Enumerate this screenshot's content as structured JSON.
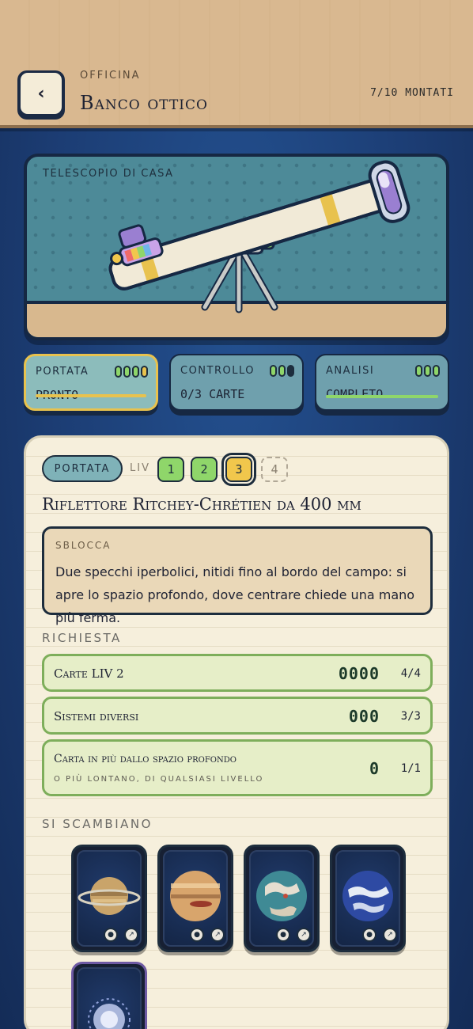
{
  "header": {
    "subtitle": "OFFICINA",
    "title": "Banco ottico",
    "count": "7/10 MONTATI",
    "back_glyph": "‹"
  },
  "scene": {
    "label": "TELESCOPIO DI CASA"
  },
  "stats": [
    {
      "label": "PORTATA",
      "value": "PRONTO",
      "pips": [
        "green",
        "green",
        "green",
        "yellow"
      ],
      "bar_color": "#e8c24e",
      "active": true
    },
    {
      "label": "CONTROLLO",
      "value": "0/3 CARTE",
      "pips": [
        "green",
        "green",
        "dark"
      ],
      "bar_color": null,
      "active": false
    },
    {
      "label": "ANALISI",
      "value": "COMPLETO",
      "pips": [
        "green",
        "green",
        "green"
      ],
      "bar_color": "#8fd66a",
      "active": false
    }
  ],
  "panel": {
    "chip": "PORTATA",
    "liv_label": "LIV",
    "levels": [
      {
        "label": "1",
        "state": "green"
      },
      {
        "label": "2",
        "state": "green"
      },
      {
        "label": "3",
        "state": "current"
      },
      {
        "label": "4",
        "state": "locked"
      }
    ],
    "item_title": "Riflettore Ritchey-Chrétien da 400 mm",
    "unlock": {
      "label": "SBLOCCA",
      "text": "Due specchi iperbolici, nitidi fino al bordo del campo: si apre lo spazio profondo, dove centrare chiede una mano più ferma."
    },
    "requirements_label": "RICHIESTA",
    "requirements": [
      {
        "label": "Carte LIV 2",
        "sub": "",
        "pips": "0000",
        "count": "4/4"
      },
      {
        "label": "Sistemi diversi",
        "sub": "",
        "pips": "000",
        "count": "3/3"
      },
      {
        "label": "Carta in più dallo spazio profondo",
        "sub": "O PIÙ LONTANO, DI QUALSIASI LIVELLO",
        "pips": "0",
        "count": "1/1"
      }
    ],
    "exchange_label": "SI SCAMBIANO",
    "cards": [
      {
        "icon": "ringed-planet-icon",
        "colors": [
          "#c9a46a",
          "#7d5f3a"
        ]
      },
      {
        "icon": "gas-giant-icon",
        "colors": [
          "#d8a56c",
          "#8a5a35"
        ]
      },
      {
        "icon": "ocean-planet-icon",
        "colors": [
          "#3f8a95",
          "#e6ded0"
        ]
      },
      {
        "icon": "storm-planet-icon",
        "colors": [
          "#2e4aa3",
          "#e6ecf5"
        ]
      },
      {
        "icon": "nebula-icon",
        "colors": [
          "#b8c4e8",
          "#6e5aa3"
        ]
      }
    ]
  }
}
